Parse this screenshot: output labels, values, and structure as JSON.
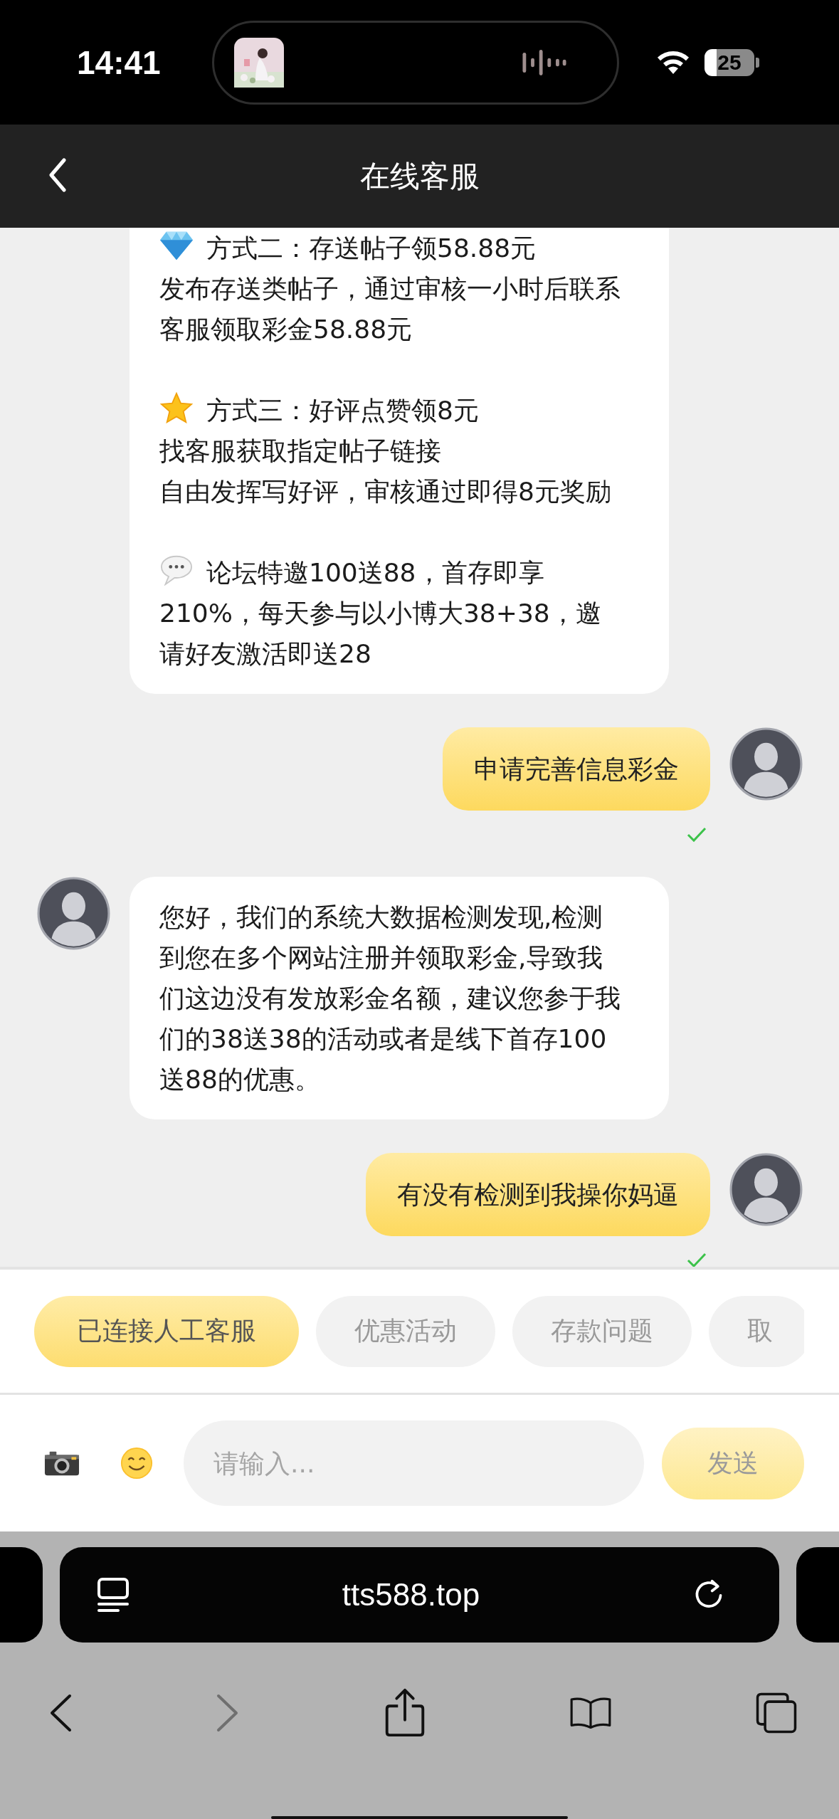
{
  "status_bar": {
    "time": "14:41",
    "battery": "25"
  },
  "header": {
    "title": "在线客服"
  },
  "messages": [
    {
      "kind": "agent",
      "avatar": false,
      "delivered": false,
      "paragraphs": [
        {
          "kind": "diamond",
          "lines": [
            "方式二：存送帖子领58.88元",
            "发布存送类帖子，通过审核一小时后联系客服领取彩金58.88元"
          ]
        },
        {
          "kind": "star",
          "lines": [
            "方式三：好评点赞领8元",
            "找客服获取指定帖子链接",
            "自由发挥写好评，审核通过即得8元奖励"
          ]
        },
        {
          "kind": "speech",
          "lines": [
            "论坛特邀100送88，首存即享",
            "210%，每天参与以小博大38+38，邀请好友激活即送28"
          ]
        }
      ]
    },
    {
      "kind": "user",
      "avatar": true,
      "delivered": true,
      "paragraphs": [
        {
          "lines": [
            "申请完善信息彩金"
          ]
        }
      ]
    },
    {
      "kind": "agent",
      "avatar": true,
      "delivered": false,
      "paragraphs": [
        {
          "lines": [
            "您好，我们的系统大数据检测发现,检测到您在多个网站注册并领取彩金,导致我们这边没有发放彩金名额，建议您参于我们的38送38的活动或者是线下首存100送88的优惠。"
          ]
        }
      ]
    },
    {
      "kind": "user",
      "avatar": true,
      "delivered": true,
      "paragraphs": [
        {
          "lines": [
            "有没有检测到我操你妈逼"
          ]
        }
      ]
    }
  ],
  "quick_replies": [
    {
      "label": "已连接人工客服",
      "selected": true
    },
    {
      "label": "优惠活动",
      "selected": false
    },
    {
      "label": "存款问题",
      "selected": false
    },
    {
      "label": "取",
      "selected": false
    }
  ],
  "composer": {
    "placeholder": "请输入...",
    "send": {
      "label": "发送",
      "disabled": true
    }
  },
  "browser": {
    "url": "tts588.top",
    "forward_disabled": true
  }
}
